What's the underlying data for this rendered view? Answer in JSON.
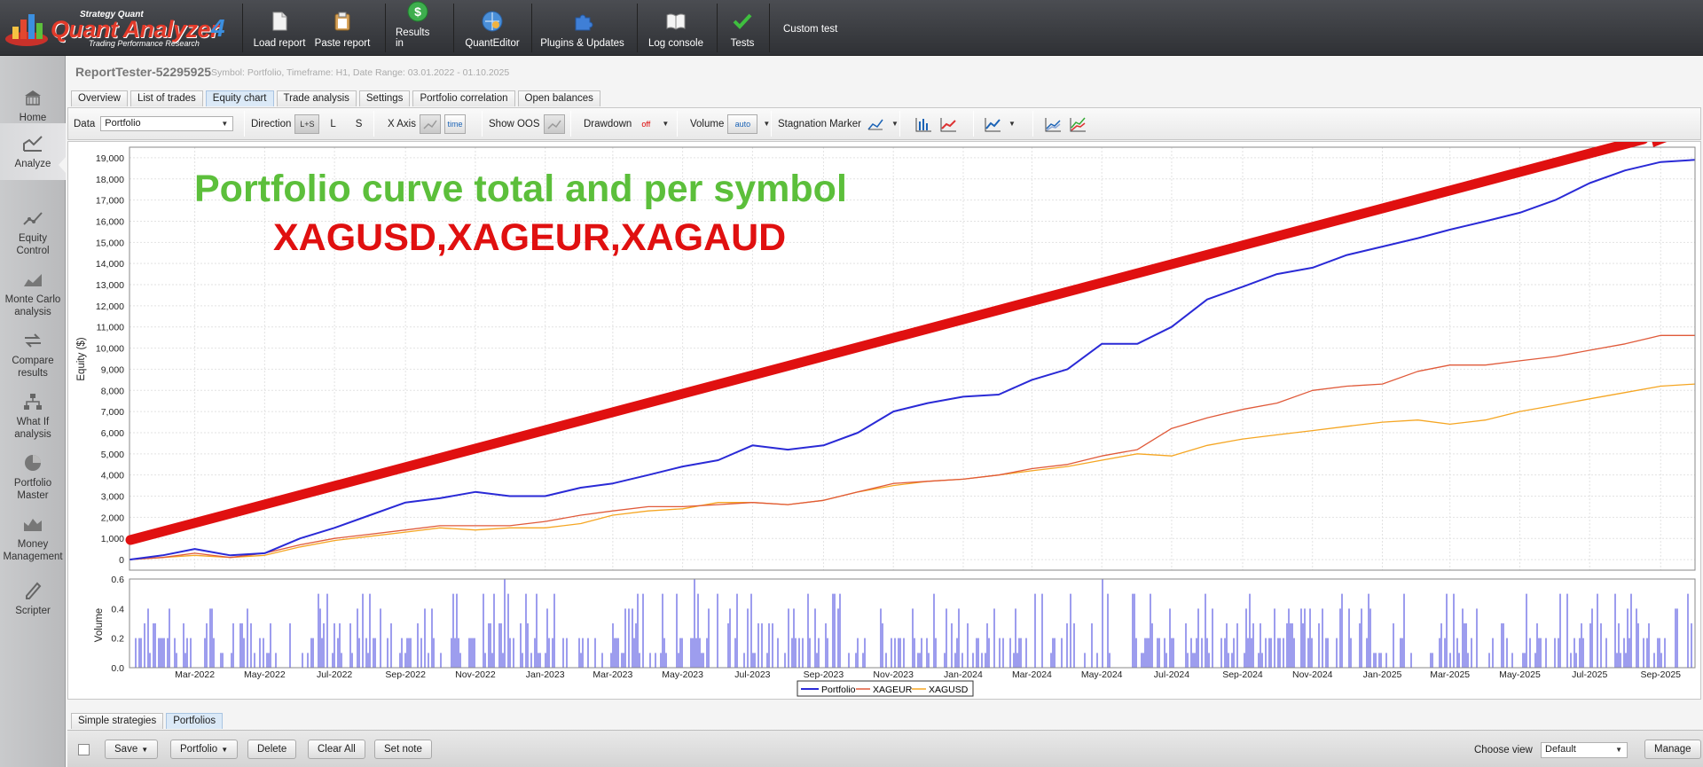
{
  "app": {
    "brand_top": "Strategy Quant",
    "brand_name": "Quant Analyzer",
    "brand_version": "4",
    "brand_sub": "Trading Performance    Research"
  },
  "toolbar": {
    "items": [
      {
        "label": "Load report",
        "icon": "load-report-icon"
      },
      {
        "label": "Paste report",
        "icon": "clipboard-icon"
      },
      {
        "label": "Results in",
        "icon": "dollar-coin-icon"
      },
      {
        "label": "QuantEditor",
        "icon": "editor-globe-icon"
      },
      {
        "label": "Plugins & Updates",
        "icon": "puzzle-icon"
      },
      {
        "label": "Log console",
        "icon": "book-icon"
      },
      {
        "label": "Tests",
        "icon": "checkmark-icon"
      }
    ],
    "custom_test": "Custom test"
  },
  "sidebar": {
    "items": [
      {
        "label1": "Home",
        "label2": "",
        "icon": "home-icon"
      },
      {
        "label1": "Analyze",
        "label2": "",
        "icon": "analyze-chart-icon",
        "active": true
      },
      {
        "label1": "Equity",
        "label2": "Control",
        "icon": "equity-control-icon"
      },
      {
        "label1": "Monte Carlo",
        "label2": "analysis",
        "icon": "monte-carlo-icon"
      },
      {
        "label1": "Compare",
        "label2": "results",
        "icon": "compare-icon"
      },
      {
        "label1": "What If",
        "label2": "analysis",
        "icon": "what-if-icon"
      },
      {
        "label1": "Portfolio",
        "label2": "Master",
        "icon": "pie-chart-icon"
      },
      {
        "label1": "Money",
        "label2": "Management",
        "icon": "money-management-icon"
      },
      {
        "label1": "Scripter",
        "label2": "",
        "icon": "scripter-icon"
      }
    ]
  },
  "report": {
    "title": "ReportTester-52295925",
    "meta": "Symbol: Portfolio, Timeframe: H1, Date Range: 03.01.2022 - 01.10.2025"
  },
  "tabs": [
    "Overview",
    "List of trades",
    "Equity chart",
    "Trade analysis",
    "Settings",
    "Portfolio correlation",
    "Open balances"
  ],
  "active_tab": "Equity chart",
  "options": {
    "data_label": "Data",
    "data_value": "Portfolio",
    "direction_label": "Direction",
    "direction_options": [
      "L+S",
      "L",
      "S"
    ],
    "x_axis_label": "X Axis",
    "x_axis_time": "time",
    "show_oos_label": "Show OOS",
    "drawdown_label": "Drawdown",
    "drawdown_value": "off",
    "volume_label": "Volume",
    "volume_value": "auto",
    "stagnation_label": "Stagnation Marker"
  },
  "annotation": {
    "line1": "Portfolio curve total and per symbol",
    "line2": "XAGUSD,XAGEUR,XAGAUD",
    "line1_color": "#5cbf3b",
    "line2_color": "#e01010",
    "arrow_color": "#e01010"
  },
  "chart_data": {
    "type": "line",
    "ylabel": "Equity ($)",
    "ylim": [
      -500,
      19500
    ],
    "yticks": [
      0,
      1000,
      2000,
      3000,
      4000,
      5000,
      6000,
      7000,
      8000,
      9000,
      10000,
      11000,
      12000,
      13000,
      14000,
      15000,
      16000,
      17000,
      18000,
      19000
    ],
    "ytick_labels": [
      "0",
      "1,000",
      "2,000",
      "3,000",
      "4,000",
      "5,000",
      "6,000",
      "7,000",
      "8,000",
      "9,000",
      "10,000",
      "11,000",
      "12,000",
      "13,000",
      "14,000",
      "15,000",
      "16,000",
      "17,000",
      "18,000",
      "19,000"
    ],
    "xlim": [
      "2022-01-03",
      "2025-10-01"
    ],
    "xticks": [
      "2022-03-01",
      "2022-05-01",
      "2022-07-01",
      "2022-09-01",
      "2022-11-01",
      "2023-01-01",
      "2023-03-01",
      "2023-05-01",
      "2023-07-01",
      "2023-09-01",
      "2023-11-01",
      "2024-01-01",
      "2024-03-01",
      "2024-05-01",
      "2024-07-01",
      "2024-09-01",
      "2024-11-01",
      "2025-01-01",
      "2025-03-01",
      "2025-05-01",
      "2025-07-01",
      "2025-09-01"
    ],
    "xtick_labels": [
      "Mar-2022",
      "May-2022",
      "Jul-2022",
      "Sep-2022",
      "Nov-2022",
      "Jan-2023",
      "Mar-2023",
      "May-2023",
      "Jul-2023",
      "Sep-2023",
      "Nov-2023",
      "Jan-2024",
      "Mar-2024",
      "May-2024",
      "Jul-2024",
      "Sep-2024",
      "Nov-2024",
      "Jan-2025",
      "Mar-2025",
      "May-2025",
      "Jul-2025",
      "Sep-2025"
    ],
    "grid": true,
    "legend_position": "bottom-center",
    "x": [
      "2022-01-03",
      "2022-02-01",
      "2022-03-01",
      "2022-04-01",
      "2022-05-01",
      "2022-06-01",
      "2022-07-01",
      "2022-08-01",
      "2022-09-01",
      "2022-10-01",
      "2022-11-01",
      "2022-12-01",
      "2023-01-01",
      "2023-02-01",
      "2023-03-01",
      "2023-04-01",
      "2023-05-01",
      "2023-06-01",
      "2023-07-01",
      "2023-08-01",
      "2023-09-01",
      "2023-10-01",
      "2023-11-01",
      "2023-12-01",
      "2024-01-01",
      "2024-02-01",
      "2024-03-01",
      "2024-04-01",
      "2024-05-01",
      "2024-06-01",
      "2024-07-01",
      "2024-08-01",
      "2024-09-01",
      "2024-10-01",
      "2024-11-01",
      "2024-12-01",
      "2025-01-01",
      "2025-02-01",
      "2025-03-01",
      "2025-04-01",
      "2025-05-01",
      "2025-06-01",
      "2025-07-01",
      "2025-08-01",
      "2025-09-01",
      "2025-10-01"
    ],
    "series": [
      {
        "name": "Portfolio",
        "color": "#2a2ad6",
        "values": [
          0,
          200,
          500,
          200,
          300,
          1000,
          1500,
          2100,
          2700,
          2900,
          3200,
          3000,
          3000,
          3400,
          3600,
          4000,
          4400,
          4700,
          5400,
          5200,
          5400,
          6000,
          7000,
          7400,
          7700,
          7800,
          8500,
          9000,
          10200,
          10200,
          11000,
          12300,
          12900,
          13500,
          13800,
          14400,
          14800,
          15200,
          15600,
          16000,
          16400,
          17000,
          17800,
          18400,
          18800,
          18900
        ]
      },
      {
        "name": "XAGEUR",
        "color": "#e05a3a",
        "values": [
          0,
          100,
          300,
          100,
          300,
          700,
          1000,
          1200,
          1400,
          1600,
          1600,
          1600,
          1800,
          2100,
          2300,
          2500,
          2500,
          2600,
          2700,
          2600,
          2800,
          3200,
          3600,
          3700,
          3800,
          4000,
          4300,
          4500,
          4900,
          5200,
          6200,
          6700,
          7100,
          7400,
          8000,
          8200,
          8300,
          8900,
          9200,
          9200,
          9400,
          9600,
          9900,
          10200,
          10600,
          10600
        ]
      },
      {
        "name": "XAGUSD",
        "color": "#f5a623",
        "values": [
          0,
          100,
          200,
          100,
          200,
          600,
          900,
          1100,
          1300,
          1500,
          1400,
          1500,
          1500,
          1700,
          2100,
          2300,
          2400,
          2700,
          2700,
          2600,
          2800,
          3200,
          3500,
          3700,
          3800,
          4000,
          4200,
          4400,
          4700,
          5000,
          4900,
          5400,
          5700,
          5900,
          6100,
          6300,
          6500,
          6600,
          6400,
          6600,
          7000,
          7300,
          7600,
          7900,
          8200,
          8300
        ]
      }
    ],
    "volume": {
      "ylabel": "Volume",
      "ylim": [
        0,
        0.6
      ],
      "yticks": [
        0.0,
        0.2,
        0.4,
        0.6
      ],
      "ytick_labels": [
        "0.0",
        "0.2",
        "0.4",
        "0.6"
      ]
    }
  },
  "bottom_tabs": [
    "Simple strategies",
    "Portfolios"
  ],
  "bottom_active_tab": "Portfolios",
  "bottom_bar": {
    "save": "Save",
    "portfolio": "Portfolio",
    "delete": "Delete",
    "clear_all": "Clear All",
    "set_note": "Set note",
    "choose_view_label": "Choose view",
    "choose_view_value": "Default",
    "manage": "Manage"
  }
}
